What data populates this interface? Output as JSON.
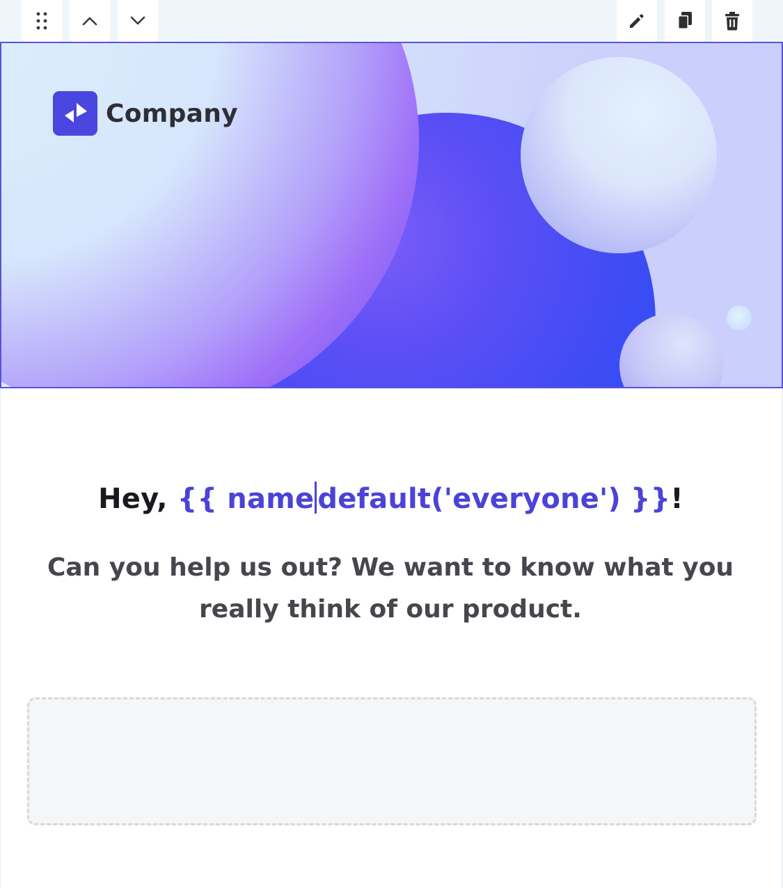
{
  "toolbar": {
    "left_icons": [
      "drag-handle-icon",
      "chevron-up-icon",
      "chevron-down-icon"
    ],
    "right_icons": [
      "pencil-icon",
      "duplicate-icon",
      "trash-icon"
    ]
  },
  "banner": {
    "logo_text": "Company",
    "selected_border_color": "#5a52d6",
    "logo_color": "#4a46df"
  },
  "greeting": {
    "prefix": "Hey, ",
    "variable_before_cursor": "{{ name",
    "variable_after_cursor": "default('everyone') }}",
    "suffix": "!",
    "variable_color": "#4b43d8"
  },
  "subtitle": "Can you help us out? We want to know what you really think of our product.",
  "dropzone": {
    "border_color": "#d6d8dc",
    "background": "#f4f6f8"
  }
}
